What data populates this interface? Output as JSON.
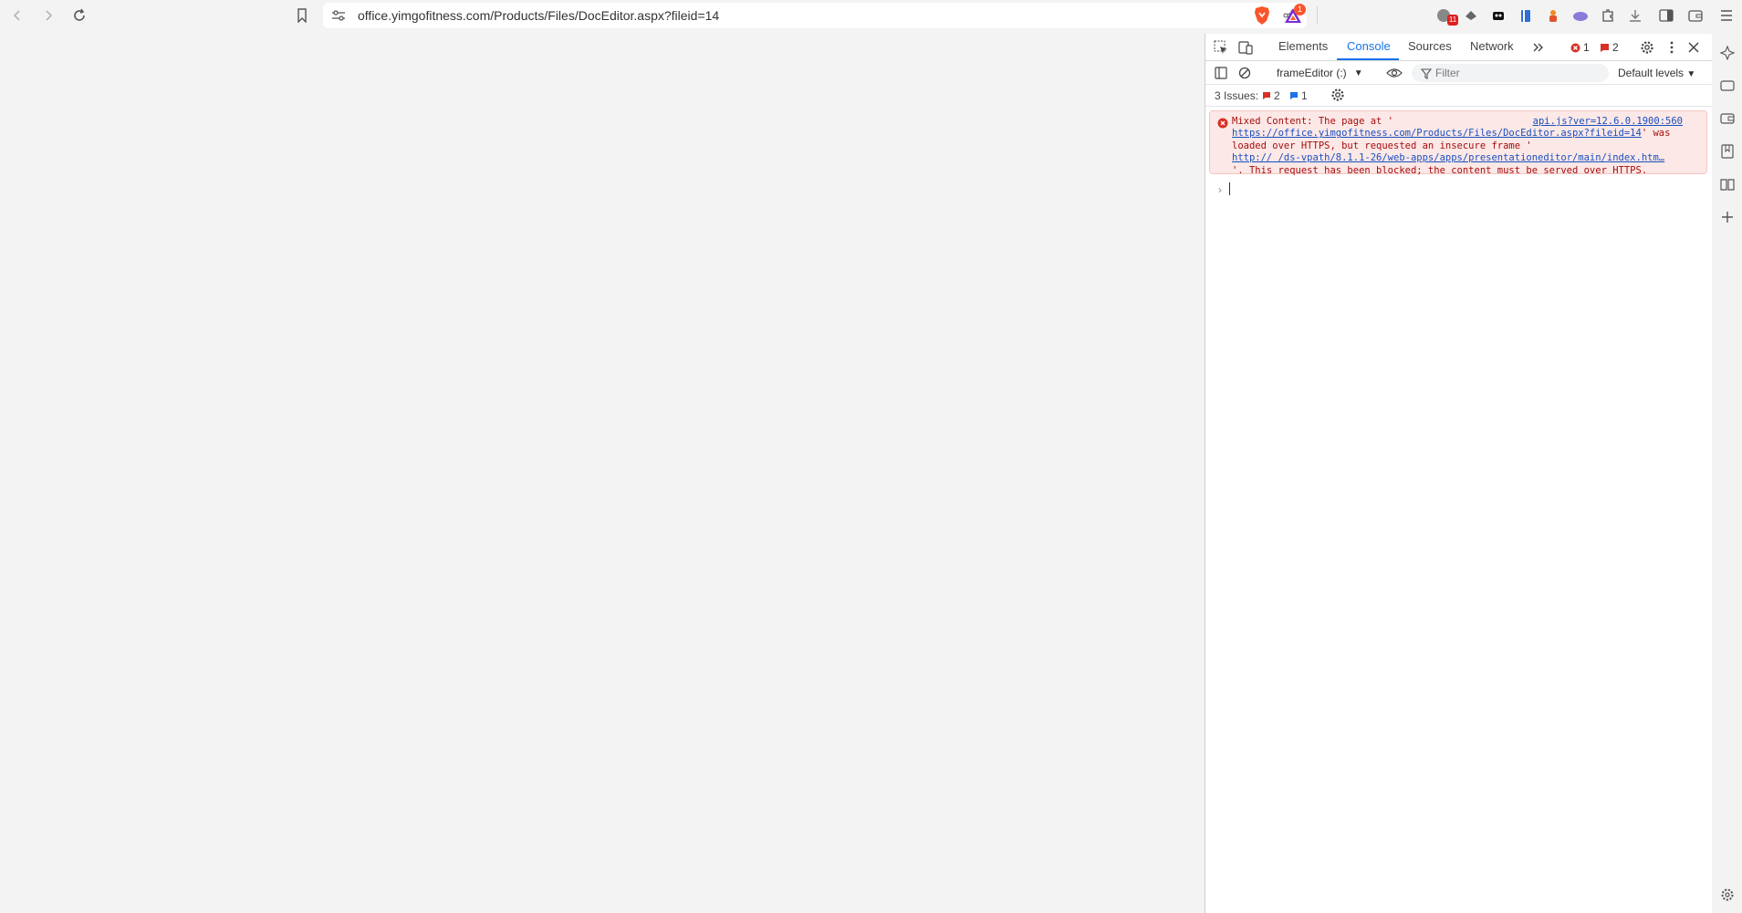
{
  "browser": {
    "url": "office.yimgofitness.com/Products/Files/DocEditor.aspx?fileid=14",
    "rewards_badge": "1",
    "ext_badge": "11",
    "icons": [
      "back-icon",
      "forward-icon",
      "reload-icon",
      "bookmark-icon",
      "site-settings-icon",
      "share-icon",
      "brave-shields-icon",
      "brave-rewards-icon",
      "extension-icon",
      "puzzle-icon",
      "download-icon",
      "sidebar-icon",
      "wallet-icon",
      "menu-icon"
    ]
  },
  "devtools": {
    "tabs": [
      "Elements",
      "Console",
      "Sources",
      "Network"
    ],
    "active_tab": "Console",
    "error_count": "1",
    "warning_count": "2",
    "context": "frameEditor (:)",
    "filter_placeholder": "Filter",
    "levels": "Default levels",
    "issues_label": "3 Issues:",
    "issues_red": "2",
    "issues_blue": "1",
    "message": {
      "part1": "Mixed Content: The page at '",
      "link1": "https://office.yimgofitness.com/Products/Files/DocEditor.aspx?fileid=14",
      "part2": "' was loaded over HTTPS, but requested an insecure frame '",
      "link2": "http:// /ds-vpath/8.1.1-26/web-apps/apps/presentationeditor/main/index.htm…",
      "part3": "'. This request has been blocked; the content must be served over HTTPS.",
      "source": "api.js?ver=12.6.0.1900:560"
    },
    "prompt": "›"
  },
  "colors": {
    "accent": "#1a73e8",
    "error_bg": "#fce8e6",
    "error_text": "#a50e0e",
    "link": "#1a4fc0"
  }
}
